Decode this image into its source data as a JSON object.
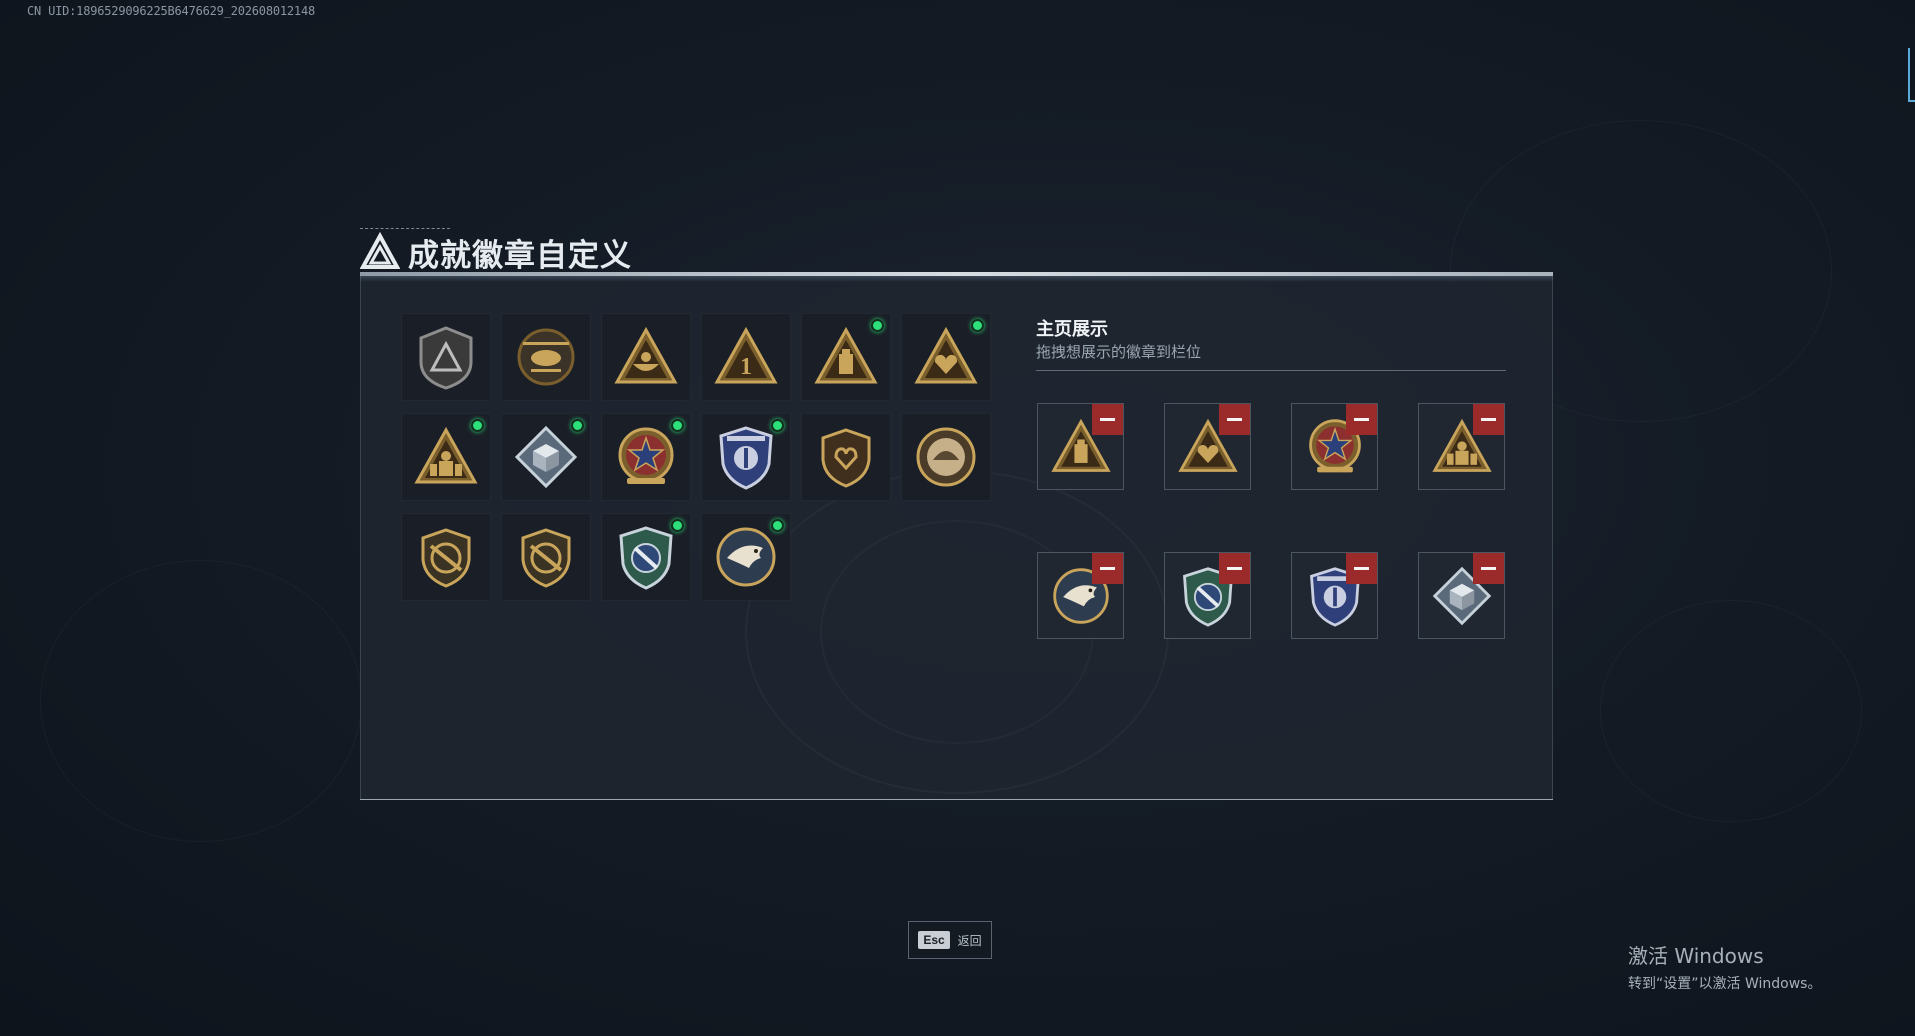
{
  "uid_text": "CN UID:1896529096225B6476629_202608012148",
  "title": "成就徽章自定义",
  "showcase": {
    "title": "主页展示",
    "subtitle": "拖拽想展示的徽章到栏位"
  },
  "badges": [
    {
      "icon": "shield-triangle-badge",
      "new": false
    },
    {
      "icon": "helicopter-badge",
      "new": false
    },
    {
      "icon": "triangle-bowl-badge",
      "new": false
    },
    {
      "icon": "triangle-number-one-badge",
      "new": false
    },
    {
      "icon": "triangle-bottle-badge",
      "new": true
    },
    {
      "icon": "triangle-heart-badge",
      "new": true
    },
    {
      "icon": "triangle-soldier-badge",
      "new": true
    },
    {
      "icon": "diamond-cube-badge",
      "new": true
    },
    {
      "icon": "star-medal-badge",
      "new": true
    },
    {
      "icon": "police-shield-badge",
      "new": true
    },
    {
      "icon": "shield-heart-badge",
      "new": false
    },
    {
      "icon": "round-helmet-badge",
      "new": false
    },
    {
      "icon": "shield-rifle-badge",
      "new": false
    },
    {
      "icon": "shield-rifle-badge-2",
      "new": false
    },
    {
      "icon": "wrench-shield-badge",
      "new": true
    },
    {
      "icon": "eagle-badge",
      "new": true
    }
  ],
  "slots": [
    {
      "icon": "triangle-bottle-badge"
    },
    {
      "icon": "triangle-heart-badge"
    },
    {
      "icon": "star-medal-badge"
    },
    {
      "icon": "triangle-soldier-badge"
    },
    {
      "icon": "eagle-badge"
    },
    {
      "icon": "wrench-shield-badge"
    },
    {
      "icon": "police-shield-badge"
    },
    {
      "icon": "diamond-cube-badge"
    }
  ],
  "footer": {
    "esc_key": "Esc",
    "esc_label": "返回"
  },
  "activation": {
    "line1": "激活 Windows",
    "line2": "转到“设置”以激活 Windows。"
  },
  "colors": {
    "new_dot": "#2ee07a",
    "remove_button": "#9b2b2b",
    "gold": "#c9a55c"
  }
}
